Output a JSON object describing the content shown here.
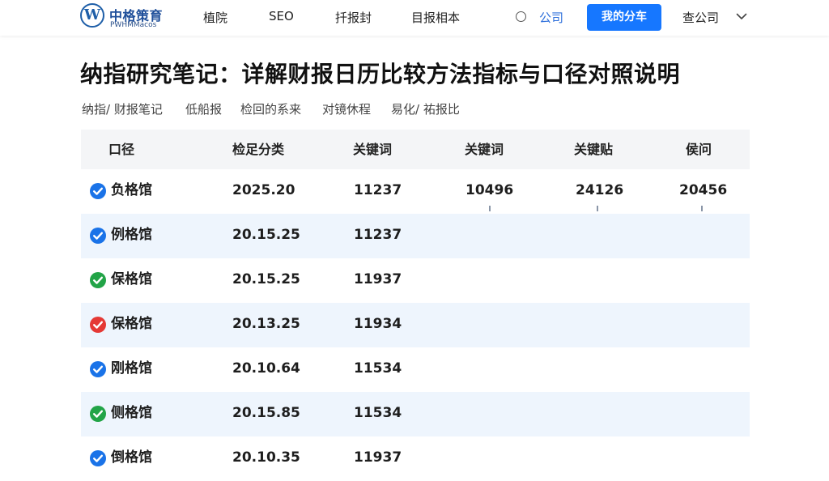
{
  "brand": {
    "logo_letter": "W",
    "name": "中格策育",
    "tagline": "PWHMMacos"
  },
  "nav": {
    "items": [
      "植院",
      "SEO",
      "扦报封",
      "目报相本"
    ],
    "link": "公司",
    "cta": "我的分车",
    "company": "查公司"
  },
  "page": {
    "title": "纳指研究笔记：详解财报日历比较方法指标与口径对照说明",
    "breadcrumb": [
      "纳指/ 财报笔记",
      "低船报",
      "检回的系来",
      "对镜休程",
      "易化/ 祐报比"
    ]
  },
  "table": {
    "headers": [
      "口径",
      "检足分类",
      "关键词",
      "关键词",
      "关键贴",
      "侯问"
    ],
    "rows": [
      {
        "status": "blue",
        "name": "负格馆",
        "period": "2025.20",
        "value": "11237",
        "extra": [
          "10496",
          "24126",
          "20456"
        ]
      },
      {
        "status": "blue",
        "name": "例格馆",
        "period": "20.15.25",
        "value": "11237"
      },
      {
        "status": "green",
        "name": "保格馆",
        "period": "20.15.25",
        "value": "11937"
      },
      {
        "status": "red",
        "name": "保格馆",
        "period": "20.13.25",
        "value": "11934"
      },
      {
        "status": "blue",
        "name": "刚格馆",
        "period": "20.10.64",
        "value": "11534"
      },
      {
        "status": "green",
        "name": "侧格馆",
        "period": "20.15.85",
        "value": "11534"
      },
      {
        "status": "blue",
        "name": "倒格馆",
        "period": "20.10.35",
        "value": "11937"
      }
    ]
  },
  "colors": {
    "accent": "#1677ff",
    "blue": "#1a73e8",
    "green": "#22a447",
    "red": "#e53935",
    "row_alt": "#eef5fd",
    "header_bg": "#f4f5f7"
  },
  "icons": {
    "status": "check-circle-icon",
    "radio": "radio-icon",
    "dropdown": "chevron-down-icon"
  }
}
